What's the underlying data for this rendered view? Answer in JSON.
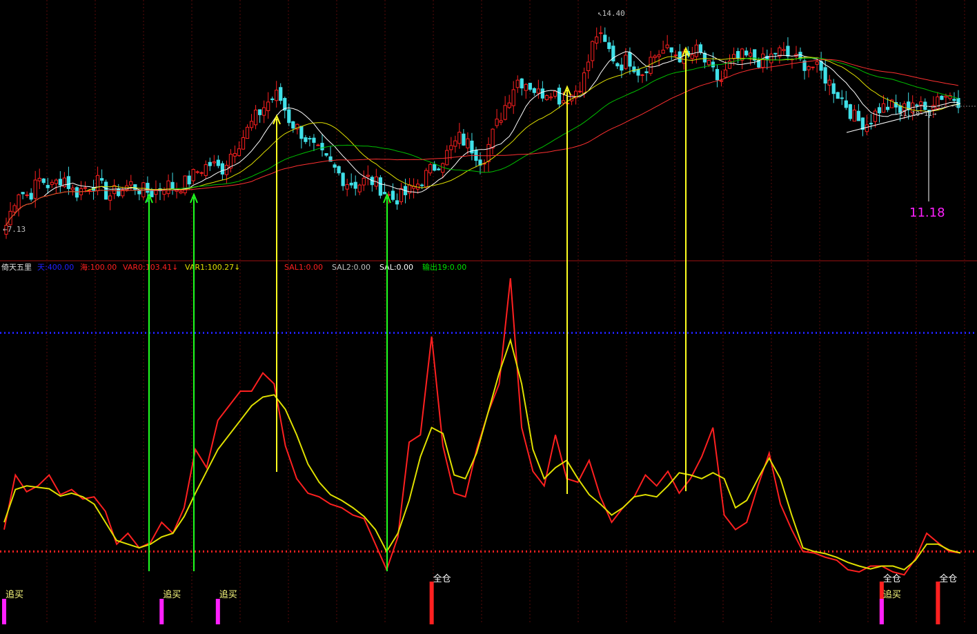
{
  "chart_data": [
    {
      "type": "candlestick",
      "panel": "price",
      "y_axis": "price",
      "ylim": [
        6.5,
        14.8
      ],
      "price_labels": {
        "low_marker": "7.13",
        "high_marker": "14.40",
        "date_marker": "11.10-11",
        "current": "11.18"
      },
      "moving_average_colors": [
        "#ffffff",
        "#e0e000",
        "#00c000",
        "#ff3030"
      ],
      "candle_colors": {
        "up": "#ff2020",
        "down": "#40e0e8"
      },
      "close_path": [
        7.3,
        8.5,
        8.3,
        8.9,
        8.6,
        9.0,
        8.4,
        8.6,
        8.8,
        8.3,
        8.5,
        8.7,
        8.5,
        8.4,
        8.7,
        8.6,
        8.8,
        9.2,
        9.4,
        9.2,
        9.9,
        10.4,
        11.0,
        11.5,
        11.8,
        10.9,
        10.5,
        10.0,
        9.6,
        9.2,
        8.8,
        8.7,
        8.9,
        8.6,
        8.2,
        8.3,
        8.6,
        9.0,
        9.4,
        9.8,
        10.3,
        10.0,
        9.5,
        10.5,
        11.4,
        12.3,
        12.2,
        11.8,
        12.0,
        11.6,
        11.8,
        12.4,
        13.9,
        13.4,
        12.8,
        13.0,
        12.5,
        13.1,
        13.3,
        13.2,
        13.0,
        13.3,
        12.7,
        12.2,
        12.9,
        13.1,
        13.0,
        12.9,
        13.3,
        13.1,
        12.9,
        12.8,
        12.5,
        12.0,
        11.5,
        10.9,
        10.8,
        11.3,
        11.4,
        11.2,
        11.6,
        11.2,
        11.7,
        11.8,
        11.6
      ]
    },
    {
      "type": "line",
      "panel": "indicator",
      "title": "倚天五里",
      "legend": [
        {
          "name": "天",
          "value": "400.00",
          "color": "#2020ff"
        },
        {
          "name": "海",
          "value": "100.00",
          "color": "#ff2020"
        },
        {
          "name": "VAR0",
          "value": "103.41",
          "color": "#ff2020",
          "arrow": "↓"
        },
        {
          "name": "VAR1",
          "value": "100.27",
          "color": "#e0e000",
          "arrow": "↓"
        },
        {
          "name": "SAL1",
          "value": "0.00",
          "color": "#ff2020"
        },
        {
          "name": "SAL2",
          "value": "0.00",
          "color": "#c0c0c0"
        },
        {
          "name": "SAL",
          "value": "0.00",
          "color": "#ffffff"
        },
        {
          "name": "输出19",
          "value": "0.00",
          "color": "#00e000"
        }
      ],
      "ylim": [
        0,
        480
      ],
      "reference_lines": [
        {
          "name": "天",
          "value": 400,
          "color": "#2020ff",
          "style": "dotted"
        },
        {
          "name": "海",
          "value": 100,
          "color": "#ff2020",
          "style": "dotted"
        }
      ],
      "series": [
        {
          "name": "VAR0",
          "color": "#ff2020",
          "values": [
            130,
            205,
            182,
            190,
            205,
            178,
            185,
            172,
            175,
            155,
            110,
            125,
            105,
            112,
            140,
            125,
            160,
            240,
            215,
            280,
            300,
            320,
            320,
            345,
            330,
            245,
            200,
            180,
            175,
            165,
            160,
            150,
            145,
            110,
            75,
            120,
            250,
            260,
            395,
            245,
            180,
            175,
            240,
            290,
            330,
            475,
            270,
            210,
            190,
            260,
            200,
            195,
            225,
            175,
            140,
            160,
            175,
            205,
            190,
            210,
            180,
            200,
            230,
            270,
            150,
            130,
            140,
            190,
            235,
            165,
            130,
            100,
            98,
            92,
            88,
            75,
            72,
            80,
            80,
            72,
            68,
            90,
            125,
            112,
            100,
            98
          ]
        },
        {
          "name": "VAR1",
          "color": "#e0e000",
          "values": [
            140,
            185,
            190,
            188,
            186,
            176,
            180,
            175,
            165,
            140,
            115,
            110,
            105,
            110,
            120,
            125,
            148,
            180,
            210,
            240,
            260,
            280,
            300,
            312,
            315,
            295,
            260,
            220,
            195,
            178,
            170,
            160,
            148,
            130,
            100,
            125,
            170,
            230,
            270,
            262,
            205,
            200,
            235,
            290,
            345,
            390,
            330,
            240,
            200,
            215,
            225,
            200,
            178,
            165,
            150,
            160,
            175,
            178,
            175,
            190,
            208,
            205,
            200,
            208,
            200,
            160,
            170,
            200,
            228,
            200,
            150,
            105,
            100,
            97,
            92,
            85,
            80,
            76,
            80,
            80,
            75,
            88,
            110,
            110,
            102,
            98
          ]
        }
      ],
      "signals": [
        {
          "label": "追买",
          "bar": 0
        },
        {
          "label": "追买",
          "bar": 14
        },
        {
          "label": "追买",
          "bar": 19
        },
        {
          "label": "全仓",
          "bar": 38
        },
        {
          "label": "全仓",
          "bar": 78
        },
        {
          "label": "全仓",
          "bar": 83
        },
        {
          "label": "追买",
          "bar": 78
        },
        {
          "label": "追买",
          "bar": 89
        },
        {
          "label": "全仓",
          "bar": 89
        }
      ]
    }
  ]
}
